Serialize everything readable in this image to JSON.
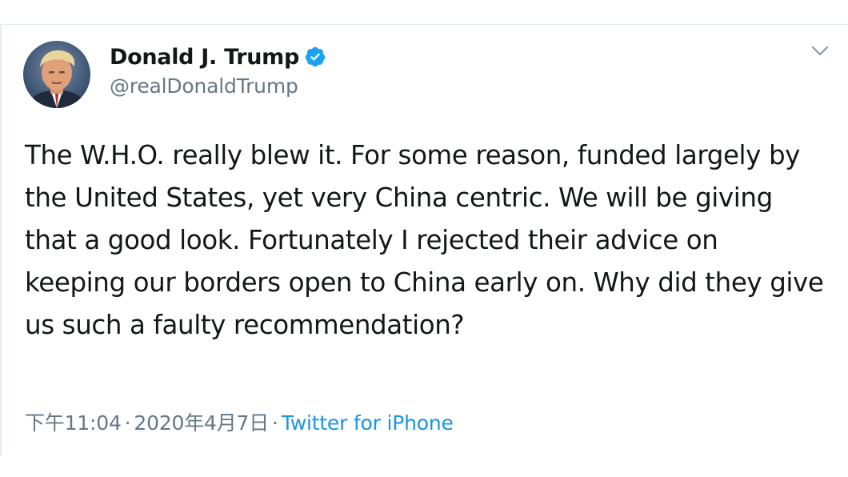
{
  "tweet": {
    "author": {
      "display_name": "Donald J. Trump",
      "handle": "@realDonaldTrump",
      "verified": true,
      "verified_icon": "verified-badge-icon",
      "verified_color": "#1da1f2"
    },
    "menu_icon": "chevron-down-icon",
    "text": "The W.H.O. really blew it. For some reason, funded largely by the United States, yet very China centric. We will be giving that a good look. Fortunately I rejected their advice on keeping our borders open to China early on. Why did they give us such a faulty recommendation?",
    "time": "下午11:04",
    "separator": "·",
    "date": "2020年4月7日",
    "source": "Twitter for iPhone"
  },
  "colors": {
    "text_primary": "#14171a",
    "text_secondary": "#657786",
    "link": "#1b95e0"
  }
}
